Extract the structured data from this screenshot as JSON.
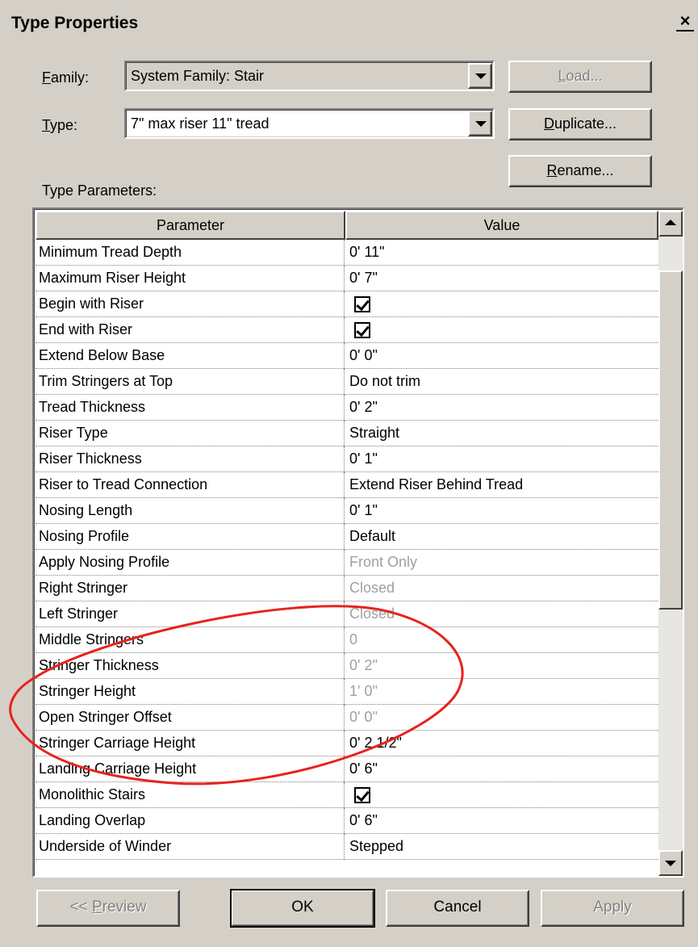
{
  "dialog": {
    "title": "Type Properties",
    "close_glyph": "×"
  },
  "family": {
    "label_key": "F",
    "label_rest": "amily:",
    "value": "System Family: Stair"
  },
  "type": {
    "label_key": "T",
    "label_rest": "ype:",
    "value": "7\" max riser 11\" tread"
  },
  "buttons": {
    "load_key": "L",
    "load_rest": "oad...",
    "duplicate_key": "D",
    "duplicate_rest": "uplicate...",
    "rename_key": "R",
    "rename_rest": "ename...",
    "preview_pre": "<< ",
    "preview_key": "P",
    "preview_rest": "review",
    "ok": "OK",
    "cancel": "Cancel",
    "apply": "Apply"
  },
  "type_parameters_label": "Type Parameters:",
  "table": {
    "headers": {
      "parameter": "Parameter",
      "value": "Value"
    },
    "rows": [
      {
        "param": "Minimum Tread Depth",
        "value": "0'  11\"",
        "kind": "text"
      },
      {
        "param": "Maximum Riser Height",
        "value": "0'  7\"",
        "kind": "text"
      },
      {
        "param": "Begin with Riser",
        "value": "",
        "kind": "check"
      },
      {
        "param": "End with Riser",
        "value": "",
        "kind": "check"
      },
      {
        "param": "Extend Below Base",
        "value": "0'  0\"",
        "kind": "text"
      },
      {
        "param": "Trim Stringers at Top",
        "value": "Do not trim",
        "kind": "text"
      },
      {
        "param": "Tread Thickness",
        "value": "0'  2\"",
        "kind": "text"
      },
      {
        "param": "Riser Type",
        "value": "Straight",
        "kind": "text"
      },
      {
        "param": "Riser Thickness",
        "value": "0'  1\"",
        "kind": "text"
      },
      {
        "param": "Riser to Tread Connection",
        "value": "Extend Riser Behind Tread",
        "kind": "text"
      },
      {
        "param": "Nosing Length",
        "value": "0'  1\"",
        "kind": "text"
      },
      {
        "param": "Nosing Profile",
        "value": "Default",
        "kind": "text"
      },
      {
        "param": "Apply Nosing Profile",
        "value": "Front Only",
        "kind": "dim"
      },
      {
        "param": "Right Stringer",
        "value": "Closed",
        "kind": "dim"
      },
      {
        "param": "Left Stringer",
        "value": "Closed",
        "kind": "dim"
      },
      {
        "param": "Middle Stringers",
        "value": "0",
        "kind": "dim"
      },
      {
        "param": "Stringer Thickness",
        "value": "0'  2\"",
        "kind": "dim"
      },
      {
        "param": "Stringer Height",
        "value": "1'  0\"",
        "kind": "dim"
      },
      {
        "param": "Open Stringer Offset",
        "value": "0'  0\"",
        "kind": "dim"
      },
      {
        "param": "Stringer Carriage Height",
        "value": "0'  2 1/2\"",
        "kind": "text"
      },
      {
        "param": "Landing Carriage Height",
        "value": "0'  6\"",
        "kind": "text"
      },
      {
        "param": "Monolithic Stairs",
        "value": "",
        "kind": "check"
      },
      {
        "param": "Landing Overlap",
        "value": "0'  6\"",
        "kind": "text"
      },
      {
        "param": "Underside of Winder",
        "value": "Stepped",
        "kind": "text"
      }
    ]
  },
  "colors": {
    "annotation": "#e8221c",
    "dialog_bg": "#d4d0c8"
  }
}
